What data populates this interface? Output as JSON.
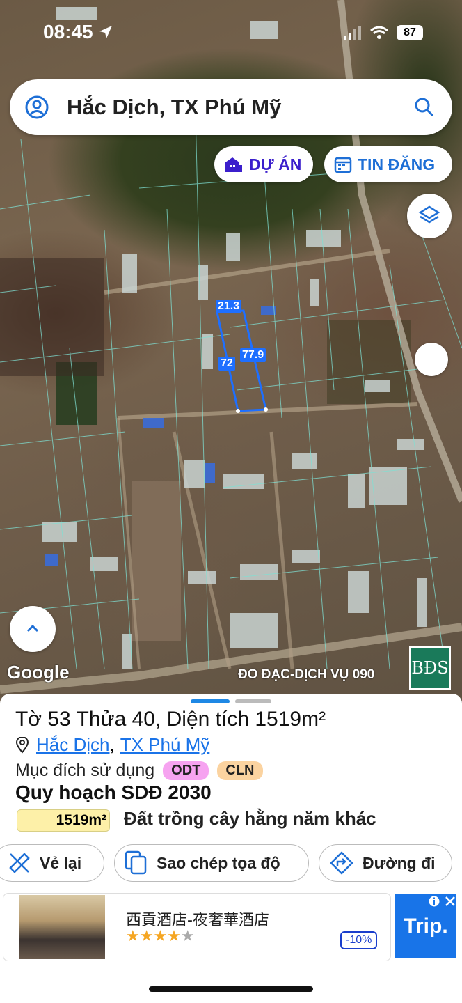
{
  "status": {
    "time": "08:45",
    "battery": "87"
  },
  "search": {
    "query": "Hắc Dịch, TX Phú Mỹ"
  },
  "chips": {
    "projects": "DỰ ÁN",
    "listings": "TIN ĐĂNG"
  },
  "map": {
    "google_label": "Google",
    "watermark": "ĐO ĐẠC-DỊCH VỤ 090",
    "logo": "BĐS",
    "dimensions": {
      "top": "21.3",
      "left": "72",
      "right": "77.9"
    },
    "parcel_color": "#1e6fff"
  },
  "parcel": {
    "title": "Tờ 53 Thửa 40, Diện tích 1519m²",
    "commune": "Hắc Dịch",
    "separator": ",",
    "town": "TX Phú Mỹ",
    "purpose_label": "Mục đích sử dụng",
    "purpose_tags": [
      {
        "label": "ODT",
        "color": "#f6a3f0"
      },
      {
        "label": "CLN",
        "color": "#fbd3a0"
      }
    ],
    "plan_title": "Quy hoạch SDĐ 2030",
    "plan_area": "1519m²",
    "plan_landuse": "Đất trồng cây hằng năm khác"
  },
  "actions": {
    "redraw": "Vẻ lại",
    "copy_coords": "Sao chép tọa độ",
    "directions": "Đường đi"
  },
  "ad": {
    "title": "西貢酒店-夜奢華酒店",
    "rating": 4,
    "rating_max": 5,
    "discount": "-10%",
    "brand": "Trip."
  },
  "icons": [
    "user-icon",
    "search-icon",
    "building-icon",
    "calendar-icon",
    "layers-icon",
    "chevron-up-icon",
    "location-pin-icon",
    "ruler-icon",
    "copy-icon",
    "directions-icon",
    "info-icon",
    "close-icon"
  ]
}
